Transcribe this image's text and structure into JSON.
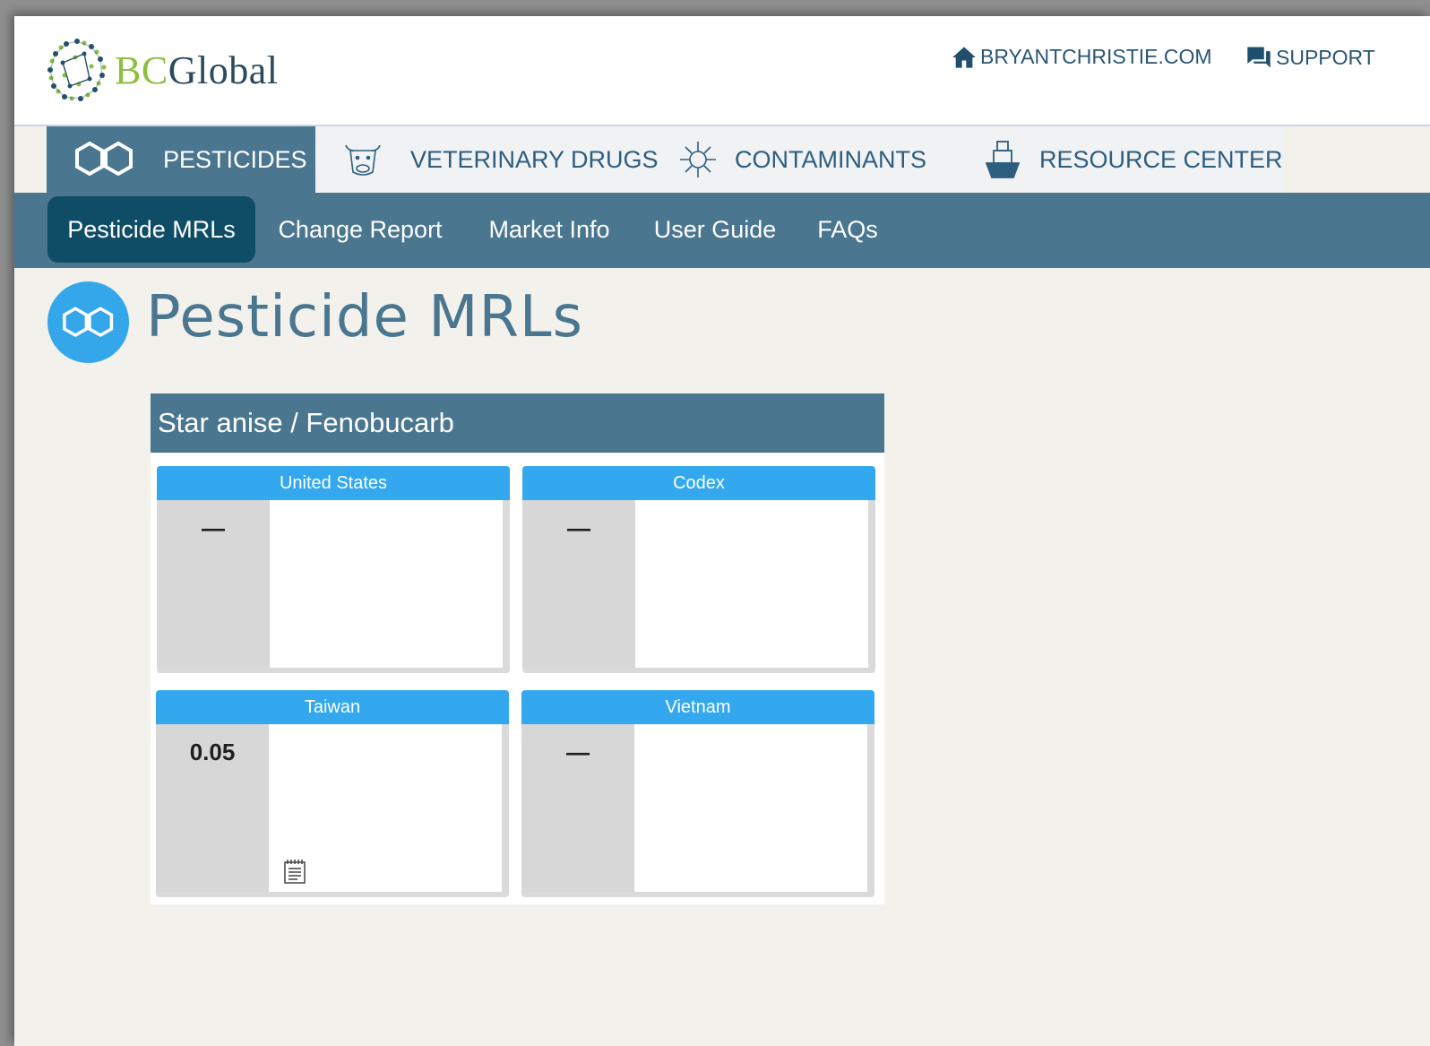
{
  "brand": {
    "logo_bc": "BC",
    "logo_global": "Global"
  },
  "header": {
    "links": [
      {
        "label": "BRYANTCHRISTIE.COM",
        "icon": "home-icon"
      },
      {
        "label": "SUPPORT",
        "icon": "chat-icon"
      }
    ]
  },
  "primary_nav": {
    "items": [
      {
        "label": "PESTICIDES",
        "icon": "molecule-icon",
        "active": true
      },
      {
        "label": "VETERINARY DRUGS",
        "icon": "cow-icon",
        "active": false
      },
      {
        "label": "CONTAMINANTS",
        "icon": "germ-icon",
        "active": false
      },
      {
        "label": "RESOURCE CENTER",
        "icon": "ship-icon",
        "active": false
      }
    ]
  },
  "secondary_nav": {
    "items": [
      {
        "label": "Pesticide MRLs",
        "active": true
      },
      {
        "label": "Change Report",
        "active": false
      },
      {
        "label": "Market Info",
        "active": false
      },
      {
        "label": "User Guide",
        "active": false
      },
      {
        "label": "FAQs",
        "active": false
      }
    ]
  },
  "page": {
    "title": "Pesticide MRLs",
    "title_icon": "molecule-icon"
  },
  "result": {
    "heading": "Star anise / Fenobucarb",
    "cards": [
      {
        "market": "United States",
        "value": "—",
        "has_note": false
      },
      {
        "market": "Codex",
        "value": "—",
        "has_note": false
      },
      {
        "market": "Taiwan",
        "value": "0.05",
        "has_note": true,
        "note_icon": "notepad-icon"
      },
      {
        "market": "Vietnam",
        "value": "—",
        "has_note": false
      }
    ]
  },
  "colors": {
    "nav_blue": "#4a7690",
    "active_dark": "#0f4d67",
    "card_blue": "#33a8ef",
    "logo_green": "#8cbf3f",
    "page_bg": "#f3f1ec"
  }
}
